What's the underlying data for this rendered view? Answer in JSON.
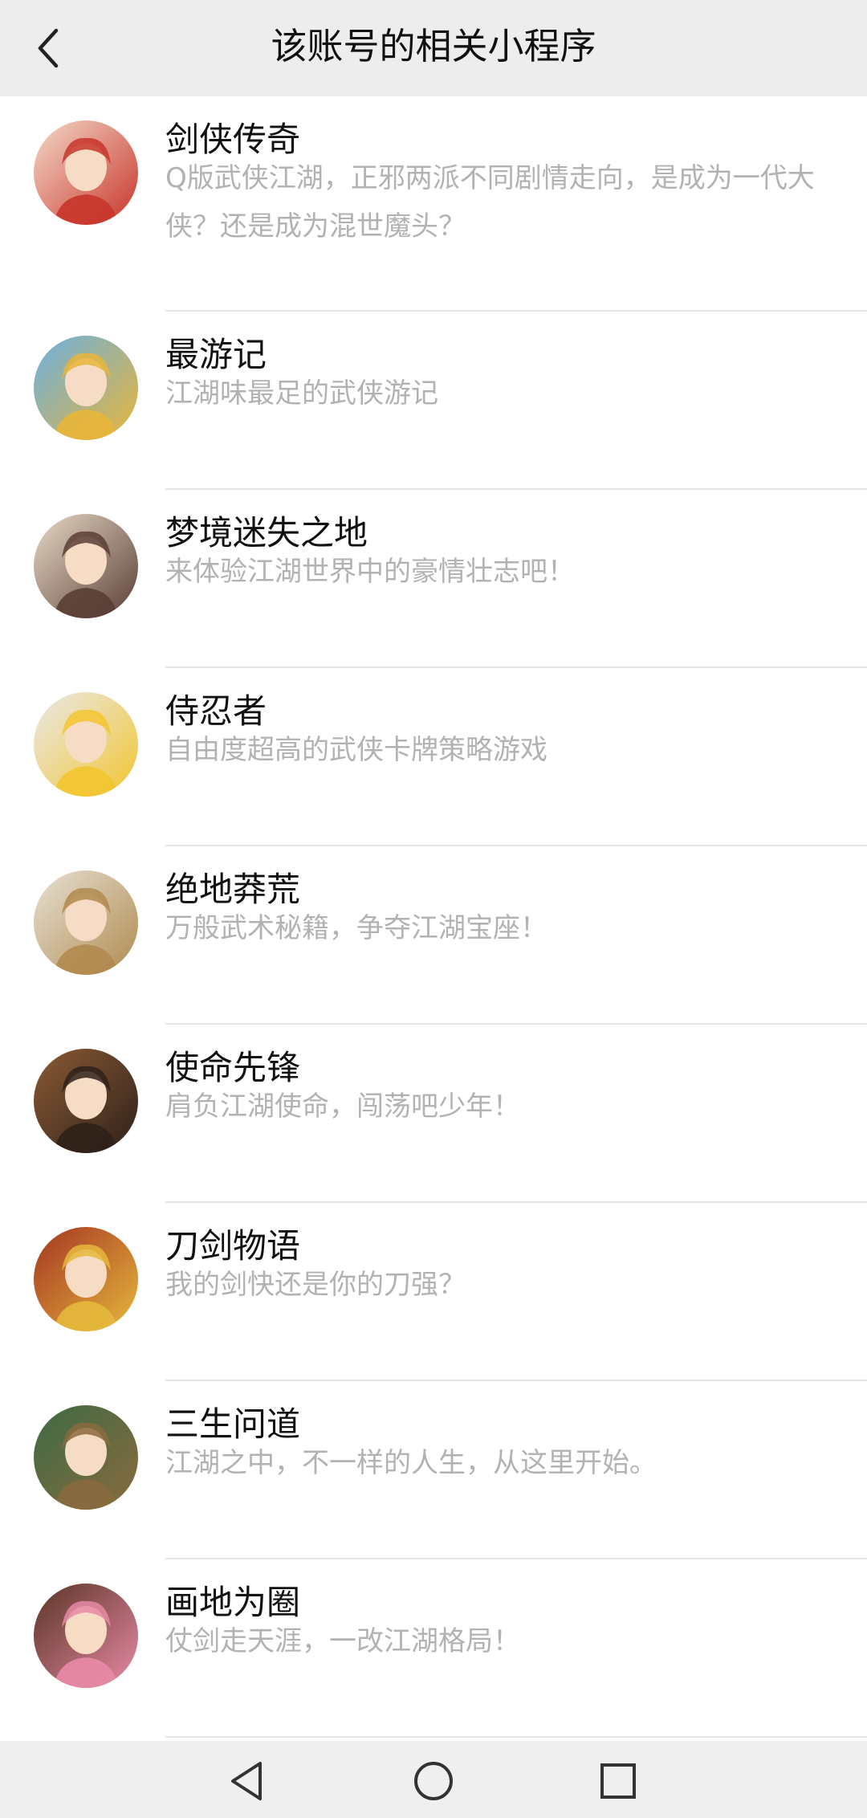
{
  "header": {
    "title": "该账号的相关小程序",
    "back_icon": "chevron-left-icon"
  },
  "items": [
    {
      "title": "剑侠传奇",
      "desc": "Q版武侠江湖，正邪两派不同剧情走向，是成为一代大侠？还是成为混世魔头？",
      "avatar_colors": [
        "#c8352b",
        "#f3d9c8"
      ]
    },
    {
      "title": "最游记",
      "desc": "江湖味最足的武侠游记",
      "avatar_colors": [
        "#e8b53a",
        "#6bb0e0"
      ]
    },
    {
      "title": "梦境迷失之地",
      "desc": "来体验江湖世界中的豪情壮志吧！",
      "avatar_colors": [
        "#5a3e36",
        "#e7d9c6"
      ]
    },
    {
      "title": "侍忍者",
      "desc": "自由度超高的武侠卡牌策略游戏",
      "avatar_colors": [
        "#f2c530",
        "#e9e9e9"
      ]
    },
    {
      "title": "绝地莽荒",
      "desc": "万般武术秘籍，争夺江湖宝座！",
      "avatar_colors": [
        "#b08a4f",
        "#e7e1d4"
      ]
    },
    {
      "title": "使命先锋",
      "desc": "肩负江湖使命，闯荡吧少年！",
      "avatar_colors": [
        "#2f211a",
        "#8a5a34"
      ]
    },
    {
      "title": "刀剑物语",
      "desc": "我的剑快还是你的刀强？",
      "avatar_colors": [
        "#e6b83c",
        "#a53522"
      ]
    },
    {
      "title": "三生问道",
      "desc": "江湖之中，不一样的人生，从这里开始。",
      "avatar_colors": [
        "#8a6a3f",
        "#3d6b43"
      ]
    },
    {
      "title": "画地为圈",
      "desc": "仗剑走天涯，一改江湖格局！",
      "avatar_colors": [
        "#e88aa6",
        "#5a3425"
      ]
    }
  ],
  "navbar": {
    "back_icon": "triangle-back-icon",
    "home_icon": "circle-home-icon",
    "recents_icon": "square-recents-icon"
  }
}
